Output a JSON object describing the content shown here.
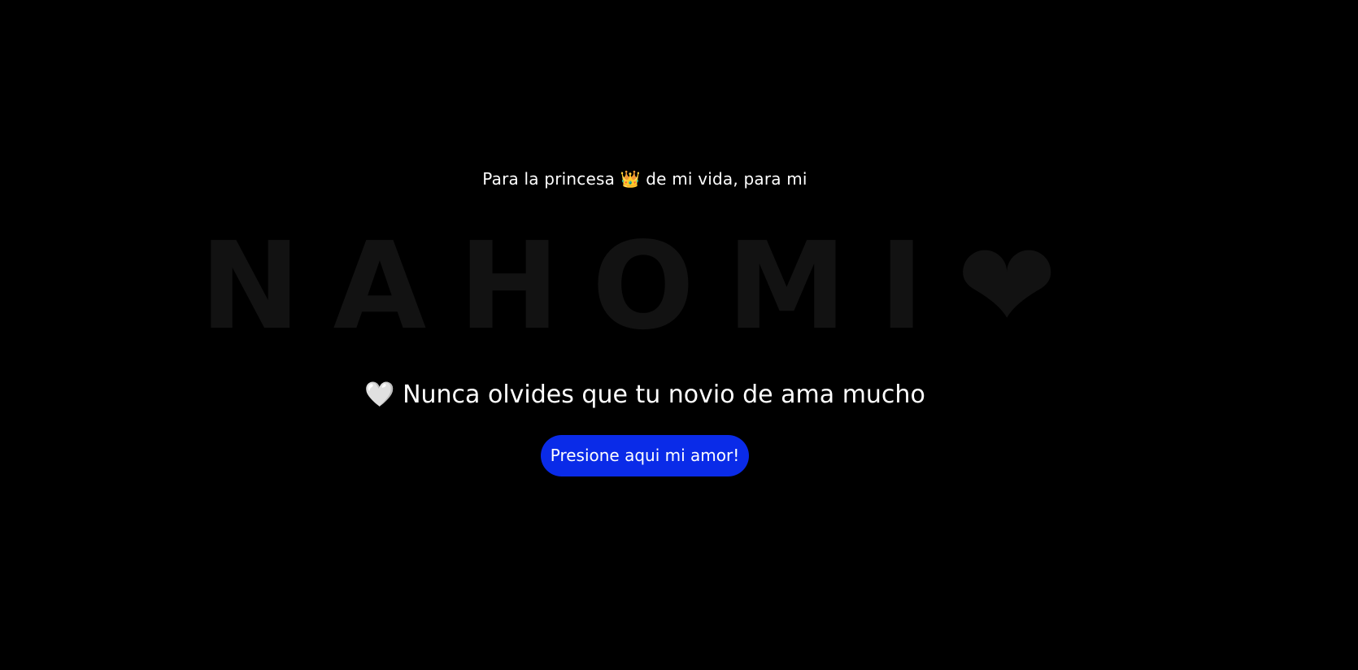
{
  "dedication": {
    "text": "Para la princesa 👑 de mi vida, para mi"
  },
  "name_banner": {
    "text": "NAHOMI❤"
  },
  "message": {
    "text": "🤍 Nunca olvides que tu novio de ama mucho"
  },
  "cta_button": {
    "label": "Presione aqui mi amor!"
  },
  "colors": {
    "background": "#000000",
    "text": "#ffffff",
    "banner": "#121212",
    "button": "#0a2be8"
  }
}
